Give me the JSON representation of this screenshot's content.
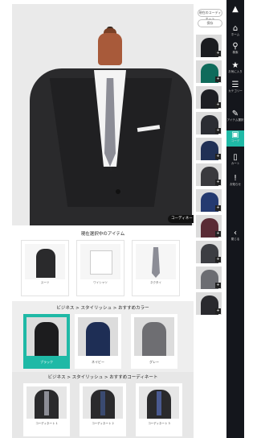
{
  "stage": {
    "badge": "コーディネートOFF"
  },
  "rail": {
    "top_button": "現在のコーディネート",
    "second_button": "保存",
    "thumbnails": [
      {
        "color": "#1b1c20",
        "tag": "+"
      },
      {
        "color": "#0f6b5b",
        "tag": "+"
      },
      {
        "color": "#1e1f24",
        "tag": "+"
      },
      {
        "color": "#2b2d33",
        "tag": "+"
      },
      {
        "color": "#203055",
        "tag": "+"
      },
      {
        "color": "#3a3a3e",
        "tag": "+"
      },
      {
        "color": "#243a70",
        "tag": "+"
      },
      {
        "color": "#5a2b35",
        "tag": "+"
      },
      {
        "color": "#3c3d42",
        "tag": "+"
      },
      {
        "color": "#6c6d72",
        "tag": "+"
      },
      {
        "color": "#2a2a2e",
        "tag": "+"
      }
    ]
  },
  "sidebar": {
    "items": [
      {
        "icon": "▲",
        "label": "",
        "name": "brand-logo-icon"
      },
      {
        "icon": "⌂",
        "label": "ホーム",
        "name": "home-icon"
      },
      {
        "icon": "⚲",
        "label": "検索",
        "name": "search-icon"
      },
      {
        "icon": "★",
        "label": "お気に入り",
        "name": "star-icon"
      },
      {
        "icon": "☰",
        "label": "カテゴリー",
        "name": "menu-icon"
      },
      {
        "icon": "✎",
        "label": "アイテム選択",
        "name": "item-select-icon"
      },
      {
        "icon": "▣",
        "label": "コーデ",
        "name": "coordinate-icon"
      },
      {
        "icon": "▯",
        "label": "カート",
        "name": "cart-icon"
      },
      {
        "icon": "!",
        "label": "お知らせ",
        "name": "notice-icon"
      },
      {
        "icon": "‹",
        "label": "閉じる",
        "name": "collapse-icon"
      }
    ]
  },
  "selected": {
    "title": "現在選択中のアイテム",
    "items": [
      {
        "caption": "スーツ",
        "kind": "jacket"
      },
      {
        "caption": "ワイシャツ",
        "kind": "shirt"
      },
      {
        "caption": "ネクタイ",
        "kind": "tie"
      }
    ]
  },
  "colors": {
    "title": "ビジネス > スタイリッシュ > おすすめカラー",
    "items": [
      {
        "caption": "ブラック",
        "coat": "#1c1c1e",
        "active": true
      },
      {
        "caption": "ネイビー",
        "coat": "#1e2e55",
        "active": false
      },
      {
        "caption": "グレー",
        "coat": "#6e6e72",
        "active": false
      }
    ]
  },
  "coordinates": {
    "title": "ビジネス > スタイリッシュ > おすすめコーディネート",
    "items": [
      {
        "caption": "コーディネート 1",
        "tie": "#8c8d96"
      },
      {
        "caption": "コーディネート 2",
        "tie": "#3a4a70"
      },
      {
        "caption": "コーディネート 3",
        "tie": "#4a5a90"
      }
    ]
  }
}
